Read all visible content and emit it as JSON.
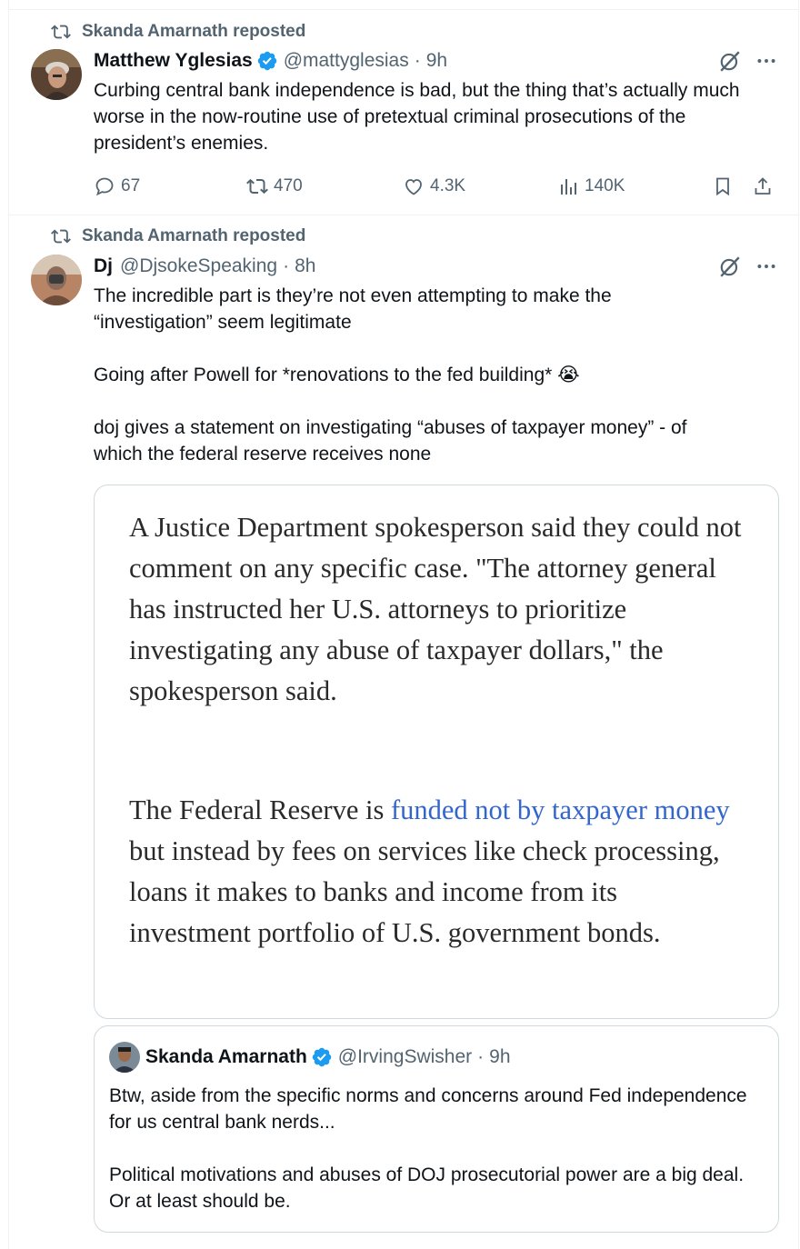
{
  "tweets": [
    {
      "reposted_by": "Skanda Amarnath reposted",
      "name": "Matthew Yglesias",
      "verified": true,
      "handle": "@mattyglesias",
      "time": "9h",
      "text": "Curbing central bank independence is bad, but the thing that’s actually much worse in the now-routine use of pretextual criminal prosecutions of the president’s enemies.",
      "stats": {
        "replies": "67",
        "reposts": "470",
        "likes": "4.3K",
        "views": "140K"
      }
    },
    {
      "reposted_by": "Skanda Amarnath reposted",
      "name": "Dj",
      "verified": false,
      "handle": "@DjsokeSpeaking",
      "time": "8h",
      "paragraphs": [
        "The incredible part is they’re not even attempting to make the “investigation” seem legitimate",
        "Going after Powell for *renovations to the fed building* 😭",
        "doj gives a statement on investigating “abuses of taxpayer money” - of which the federal reserve receives none"
      ],
      "image_card": {
        "para1": "A Justice Department spokesperson said they could not comment on any specific case. \"The attorney general has instructed her U.S. attorneys to prioritize investigating any abuse of taxpayer dollars,\" the spokesperson said.",
        "para2_before": "The Federal Reserve is ",
        "para2_link": "funded not by taxpayer money",
        "para2_after": " but instead by fees on services like check processing, loans it makes to banks and income from its investment portfolio of U.S. government bonds."
      },
      "quoted": {
        "name": "Skanda Amarnath",
        "verified": true,
        "handle": "@IrvingSwisher",
        "time": "9h",
        "paragraphs": [
          "Btw, aside from the specific norms and concerns around Fed independence for us central bank nerds...",
          "Political motivations and abuses of DOJ prosecutorial power are a big deal. Or at least should be."
        ]
      }
    }
  ],
  "colors": {
    "verified": "#1d9bf0",
    "secondary_text": "#536471",
    "link": "#3366cc"
  },
  "icons": [
    "repost-icon",
    "verified-badge-icon",
    "grok-icon",
    "more-icon",
    "reply-icon",
    "like-icon",
    "views-icon",
    "bookmark-icon",
    "share-icon"
  ]
}
